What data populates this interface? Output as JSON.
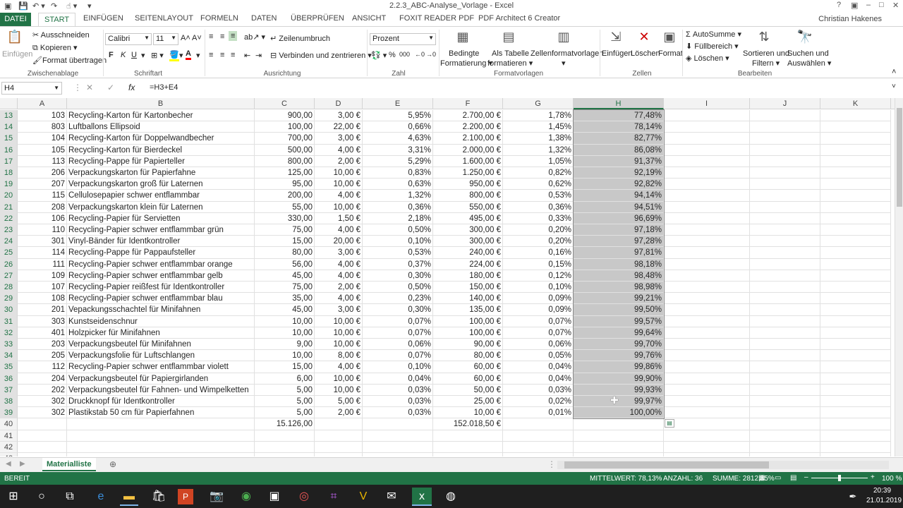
{
  "window": {
    "title": "2.2.3_ABC-Analyse_Vorlage - Excel",
    "user": "Christian Hakenes",
    "controls": [
      "?",
      "▣",
      "–",
      "□",
      "✕"
    ]
  },
  "tabs": [
    "DATEI",
    "START",
    "EINFÜGEN",
    "SEITENLAYOUT",
    "FORMELN",
    "DATEN",
    "ÜBERPRÜFEN",
    "ANSICHT",
    "FOXIT READER PDF",
    "PDF Architect 6 Creator"
  ],
  "ribbon": {
    "clipboard": {
      "paste": "Einfügen",
      "cut": "Ausschneiden",
      "copy": "Kopieren",
      "format_painter": "Format übertragen",
      "group": "Zwischenablage"
    },
    "font": {
      "name": "Calibri",
      "size": "11",
      "group": "Schriftart",
      "bold": "F",
      "italic": "K",
      "underline": "U"
    },
    "alignment": {
      "wrap": "Zeilenumbruch",
      "merge": "Verbinden und zentrieren",
      "group": "Ausrichtung"
    },
    "number": {
      "format": "Prozent",
      "percent": "%",
      "thousands": "000",
      "group": "Zahl"
    },
    "styles": {
      "conditional": "Bedingte",
      "conditional2": "Formatierung",
      "as_table": "Als Tabelle",
      "as_table2": "formatieren",
      "cell_styles": "Zellenformatvorlagen",
      "group": "Formatvorlagen"
    },
    "cells": {
      "insert": "Einfügen",
      "delete": "Löschen",
      "format": "Format",
      "group": "Zellen"
    },
    "editing": {
      "autosum": "AutoSumme",
      "fill": "Füllbereich",
      "clear": "Löschen",
      "sort": "Sortieren und",
      "sort2": "Filtern",
      "find": "Suchen und",
      "find2": "Auswählen",
      "group": "Bearbeiten"
    }
  },
  "formula_bar": {
    "name_box": "H4",
    "formula": "=H3+E4",
    "fx": "fx"
  },
  "columns": [
    "A",
    "B",
    "C",
    "D",
    "E",
    "F",
    "G",
    "H",
    "I",
    "J",
    "K"
  ],
  "rows": [
    {
      "n": "13",
      "a": "103",
      "b": "Recycling-Karton für Kartonbecher",
      "c": "900,00",
      "d": "3,00 €",
      "e": "5,95%",
      "f": "2.700,00 €",
      "g": "1,78%",
      "h": "77,48%"
    },
    {
      "n": "14",
      "a": "803",
      "b": "Luftballons Ellipsoid",
      "c": "100,00",
      "d": "22,00 €",
      "e": "0,66%",
      "f": "2.200,00 €",
      "g": "1,45%",
      "h": "78,14%"
    },
    {
      "n": "15",
      "a": "104",
      "b": "Recycling-Karton für Doppelwandbecher",
      "c": "700,00",
      "d": "3,00 €",
      "e": "4,63%",
      "f": "2.100,00 €",
      "g": "1,38%",
      "h": "82,77%"
    },
    {
      "n": "16",
      "a": "105",
      "b": "Recycling-Karton für Bierdeckel",
      "c": "500,00",
      "d": "4,00 €",
      "e": "3,31%",
      "f": "2.000,00 €",
      "g": "1,32%",
      "h": "86,08%"
    },
    {
      "n": "17",
      "a": "113",
      "b": "Recycling-Pappe für Papierteller",
      "c": "800,00",
      "d": "2,00 €",
      "e": "5,29%",
      "f": "1.600,00 €",
      "g": "1,05%",
      "h": "91,37%"
    },
    {
      "n": "18",
      "a": "206",
      "b": "Verpackungskarton für Papierfahne",
      "c": "125,00",
      "d": "10,00 €",
      "e": "0,83%",
      "f": "1.250,00 €",
      "g": "0,82%",
      "h": "92,19%"
    },
    {
      "n": "19",
      "a": "207",
      "b": "Verpackungskarton groß für Laternen",
      "c": "95,00",
      "d": "10,00 €",
      "e": "0,63%",
      "f": "950,00 €",
      "g": "0,62%",
      "h": "92,82%"
    },
    {
      "n": "20",
      "a": "115",
      "b": "Cellulosepapier schwer entflammbar",
      "c": "200,00",
      "d": "4,00 €",
      "e": "1,32%",
      "f": "800,00 €",
      "g": "0,53%",
      "h": "94,14%"
    },
    {
      "n": "21",
      "a": "208",
      "b": "Verpackungskarton klein für Laternen",
      "c": "55,00",
      "d": "10,00 €",
      "e": "0,36%",
      "f": "550,00 €",
      "g": "0,36%",
      "h": "94,51%"
    },
    {
      "n": "22",
      "a": "106",
      "b": "Recycling-Papier für Servietten",
      "c": "330,00",
      "d": "1,50 €",
      "e": "2,18%",
      "f": "495,00 €",
      "g": "0,33%",
      "h": "96,69%"
    },
    {
      "n": "23",
      "a": "110",
      "b": "Recycling-Papier schwer entflammbar grün",
      "c": "75,00",
      "d": "4,00 €",
      "e": "0,50%",
      "f": "300,00 €",
      "g": "0,20%",
      "h": "97,18%"
    },
    {
      "n": "24",
      "a": "301",
      "b": "Vinyl-Bänder für Identkontroller",
      "c": "15,00",
      "d": "20,00 €",
      "e": "0,10%",
      "f": "300,00 €",
      "g": "0,20%",
      "h": "97,28%"
    },
    {
      "n": "25",
      "a": "114",
      "b": "Recycling-Pappe für Pappaufsteller",
      "c": "80,00",
      "d": "3,00 €",
      "e": "0,53%",
      "f": "240,00 €",
      "g": "0,16%",
      "h": "97,81%"
    },
    {
      "n": "26",
      "a": "111",
      "b": "Recycling-Papier schwer entflammbar orange",
      "c": "56,00",
      "d": "4,00 €",
      "e": "0,37%",
      "f": "224,00 €",
      "g": "0,15%",
      "h": "98,18%"
    },
    {
      "n": "27",
      "a": "109",
      "b": "Recycling-Papier schwer entflammbar gelb",
      "c": "45,00",
      "d": "4,00 €",
      "e": "0,30%",
      "f": "180,00 €",
      "g": "0,12%",
      "h": "98,48%"
    },
    {
      "n": "28",
      "a": "107",
      "b": "Recycling-Papier reißfest für Identkontroller",
      "c": "75,00",
      "d": "2,00 €",
      "e": "0,50%",
      "f": "150,00 €",
      "g": "0,10%",
      "h": "98,98%"
    },
    {
      "n": "29",
      "a": "108",
      "b": "Recycling-Papier schwer entflammbar blau",
      "c": "35,00",
      "d": "4,00 €",
      "e": "0,23%",
      "f": "140,00 €",
      "g": "0,09%",
      "h": "99,21%"
    },
    {
      "n": "30",
      "a": "201",
      "b": "Vepackungsschachtel für Minifahnen",
      "c": "45,00",
      "d": "3,00 €",
      "e": "0,30%",
      "f": "135,00 €",
      "g": "0,09%",
      "h": "99,50%"
    },
    {
      "n": "31",
      "a": "303",
      "b": "Kunstseidenschnur",
      "c": "10,00",
      "d": "10,00 €",
      "e": "0,07%",
      "f": "100,00 €",
      "g": "0,07%",
      "h": "99,57%"
    },
    {
      "n": "32",
      "a": "401",
      "b": "Holzpicker für Minifahnen",
      "c": "10,00",
      "d": "10,00 €",
      "e": "0,07%",
      "f": "100,00 €",
      "g": "0,07%",
      "h": "99,64%"
    },
    {
      "n": "33",
      "a": "203",
      "b": "Verpackungsbeutel für Minifahnen",
      "c": "9,00",
      "d": "10,00 €",
      "e": "0,06%",
      "f": "90,00 €",
      "g": "0,06%",
      "h": "99,70%"
    },
    {
      "n": "34",
      "a": "205",
      "b": "Verpackungsfolie für Luftschlangen",
      "c": "10,00",
      "d": "8,00 €",
      "e": "0,07%",
      "f": "80,00 €",
      "g": "0,05%",
      "h": "99,76%"
    },
    {
      "n": "35",
      "a": "112",
      "b": "Recycling-Papier schwer entflammbar violett",
      "c": "15,00",
      "d": "4,00 €",
      "e": "0,10%",
      "f": "60,00 €",
      "g": "0,04%",
      "h": "99,86%"
    },
    {
      "n": "36",
      "a": "204",
      "b": "Verpackungsbeutel für Papiergirlanden",
      "c": "6,00",
      "d": "10,00 €",
      "e": "0,04%",
      "f": "60,00 €",
      "g": "0,04%",
      "h": "99,90%"
    },
    {
      "n": "37",
      "a": "202",
      "b": "Verpackungsbeutel für Fahnen- und Wimpelketten",
      "c": "5,00",
      "d": "10,00 €",
      "e": "0,03%",
      "f": "50,00 €",
      "g": "0,03%",
      "h": "99,93%"
    },
    {
      "n": "38",
      "a": "302",
      "b": "Druckknopf für Identkontroller",
      "c": "5,00",
      "d": "5,00 €",
      "e": "0,03%",
      "f": "25,00 €",
      "g": "0,02%",
      "h": "99,97%"
    },
    {
      "n": "39",
      "a": "302",
      "b": "Plastikstab 50 cm für Papierfahnen",
      "c": "5,00",
      "d": "2,00 €",
      "e": "0,03%",
      "f": "10,00 €",
      "g": "0,01%",
      "h": "100,00%"
    },
    {
      "n": "40",
      "a": "",
      "b": "",
      "c": "15.126,00",
      "d": "",
      "e": "",
      "f": "152.018,50 €",
      "g": "",
      "h": ""
    },
    {
      "n": "41",
      "a": "",
      "b": "",
      "c": "",
      "d": "",
      "e": "",
      "f": "",
      "g": "",
      "h": ""
    },
    {
      "n": "42",
      "a": "",
      "b": "",
      "c": "",
      "d": "",
      "e": "",
      "f": "",
      "g": "",
      "h": ""
    },
    {
      "n": "43",
      "a": "",
      "b": "",
      "c": "",
      "d": "",
      "e": "",
      "f": "",
      "g": "",
      "h": ""
    }
  ],
  "sheet": {
    "name": "Materialliste"
  },
  "status": {
    "ready": "BEREIT",
    "average": "MITTELWERT: 78,13%",
    "count": "ANZAHL: 36",
    "sum": "SUMME: 2812,85%",
    "zoom": "100 %"
  },
  "taskbar": {
    "time": "20:39",
    "date": "21.01.2019"
  },
  "colors": {
    "excel_green": "#217346",
    "selection_gray": "#c8c8c8"
  }
}
